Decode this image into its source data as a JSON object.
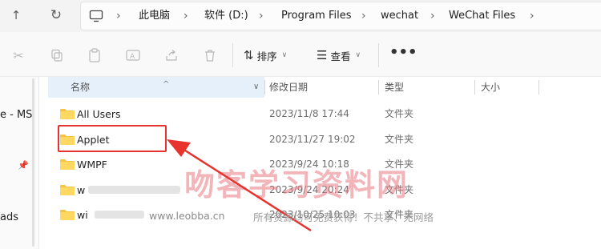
{
  "address_bar": {
    "breadcrumbs": [
      "此电脑",
      "软件 (D:)",
      "Program Files",
      "wechat",
      "WeChat Files"
    ]
  },
  "toolbar": {
    "sort_label": "排序",
    "view_label": "查看",
    "more_label": "•••",
    "disabled_icons": [
      "cut-icon",
      "copy-icon",
      "paste-icon",
      "rename-icon",
      "share-icon",
      "delete-icon"
    ]
  },
  "nav_pane": {
    "partial_item_1": "e - MS",
    "partial_item_2": "ads"
  },
  "columns": {
    "name": "名称",
    "date": "修改日期",
    "type": "类型",
    "size": "大小"
  },
  "files": [
    {
      "name": "All Users",
      "date": "2023/11/8 17:44",
      "type": "文件夹"
    },
    {
      "name": "Applet",
      "date": "2023/11/27 19:02",
      "type": "文件夹"
    },
    {
      "name": "WMPF",
      "date": "2023/9/24 10:18",
      "type": "文件夹"
    },
    {
      "name": "w",
      "date": "2023/9/24 20:24",
      "type": "文件夹"
    },
    {
      "name": "wi",
      "date": "2023/10/25 10:03",
      "type": "文件夹"
    }
  ],
  "watermark": {
    "title": "吻客学习资料网",
    "url": "www.leobba.cn",
    "note": "所有资源均可免费获得！不共享、无网络"
  },
  "colors": {
    "folder": "#f6c445",
    "highlight": "#e8322d",
    "header_selected": "#e6f0fb"
  }
}
